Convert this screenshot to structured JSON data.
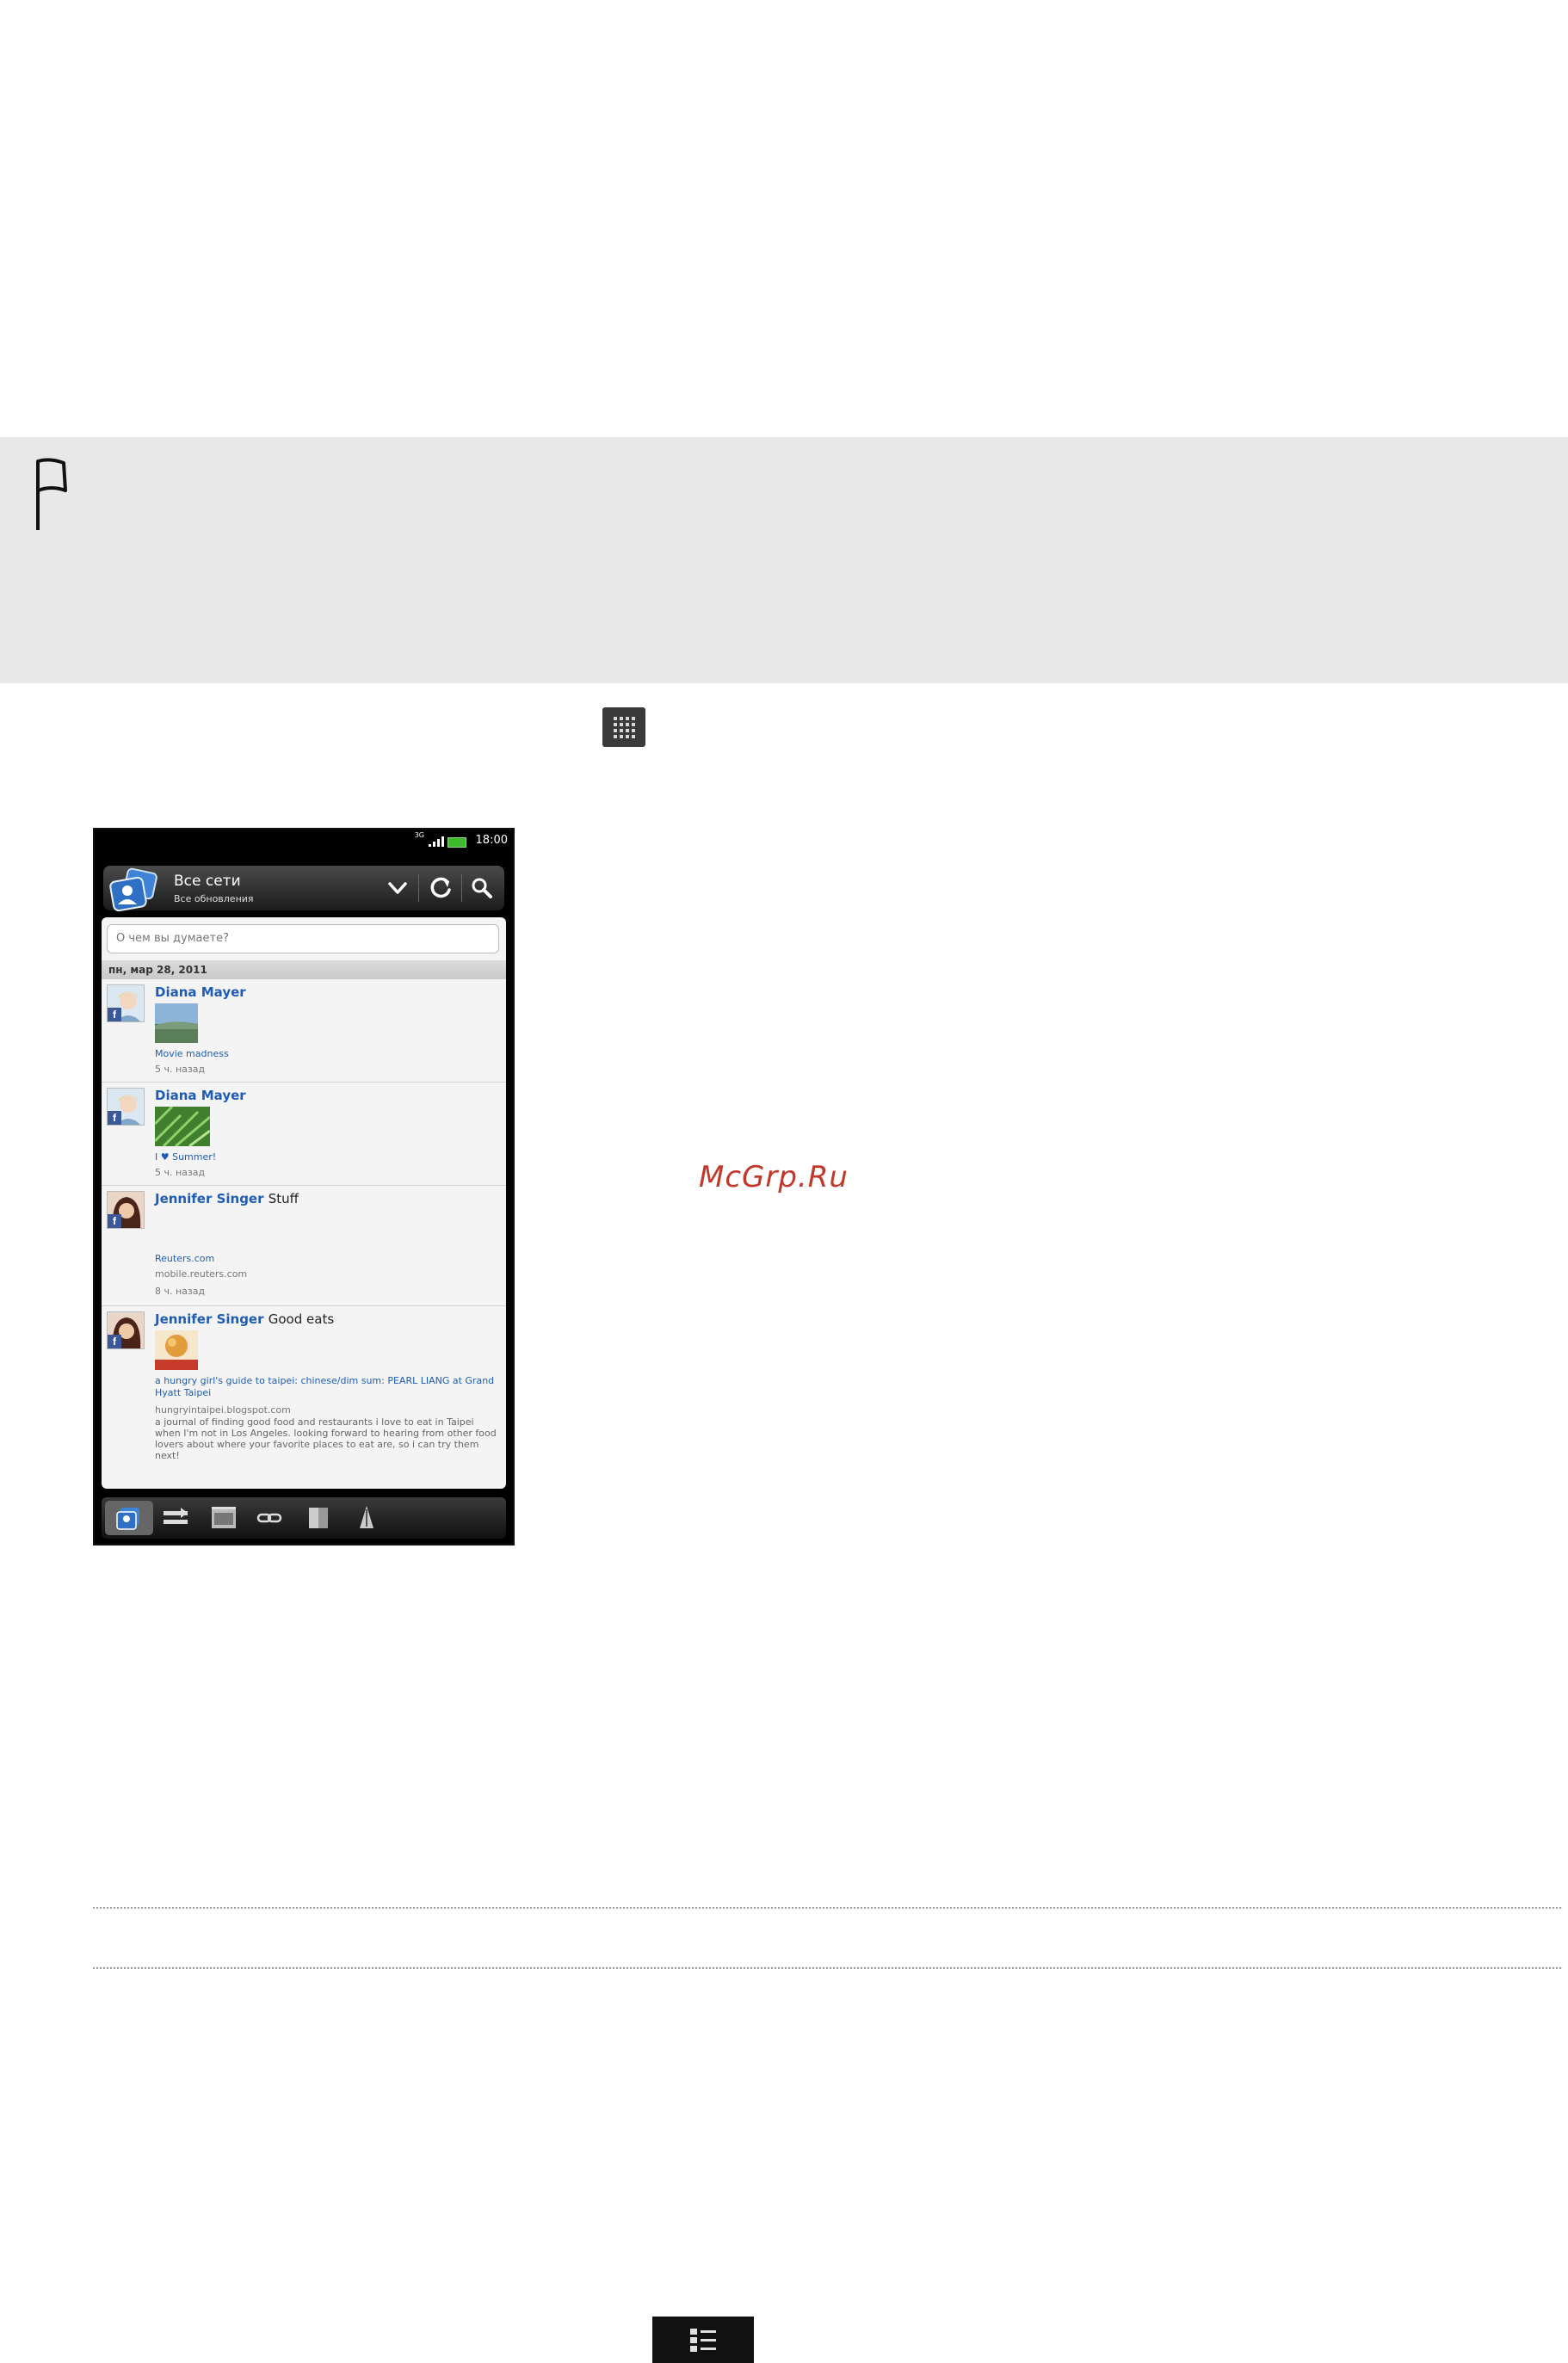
{
  "note": {
    "flag_icon": "flag-icon"
  },
  "apps_icon": "all-apps-grid-icon",
  "phone": {
    "status": {
      "network": "3G",
      "time": "18:00"
    },
    "header": {
      "title": "Все сети",
      "subtitle": "Все обновления",
      "icons": [
        "dropdown-chevron-icon",
        "refresh-icon",
        "search-icon"
      ]
    },
    "compose_placeholder": "О чем вы думаете?",
    "date_header": "пн, мар 28, 2011",
    "posts": [
      {
        "author": "Diana Mayer",
        "message": "",
        "link": "Movie madness",
        "time": "5 ч. назад"
      },
      {
        "author": "Diana Mayer",
        "message": "",
        "link": "I ♥ Summer!",
        "time": "5 ч. назад"
      },
      {
        "author": "Jennifer Singer",
        "message": "Stuff",
        "link": "Reuters.com",
        "domain": "mobile.reuters.com",
        "time": "8 ч. назад"
      },
      {
        "author": "Jennifer Singer",
        "message": "Good eats",
        "link": "a hungry girl's guide to taipei: chinese/dim sum: PEARL LIANG at Grand Hyatt Taipei",
        "domain": "hungryintaipei.blogspot.com",
        "description": "a journal of finding good food and restaurants i love to eat in Taipei when I'm not in Los Angeles. looking forward to hearing from other food lovers about where your favorite places to eat are, so i can try them next!"
      }
    ],
    "tabs": [
      "updates-tab-icon",
      "status-tab-icon",
      "photos-tab-icon",
      "links-tab-icon",
      "messages-tab-icon",
      "notifications-tab-icon"
    ]
  },
  "watermark": "McGrp.Ru",
  "menu_icon": "menu-list-icon"
}
